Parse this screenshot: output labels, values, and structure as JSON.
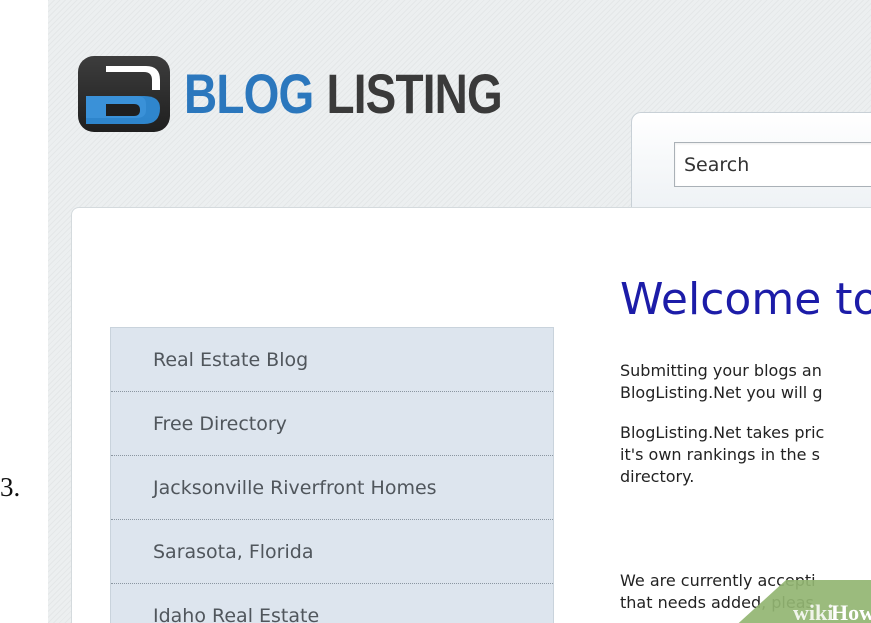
{
  "step": {
    "number": "3."
  },
  "logo": {
    "word1": "BLOG",
    "word2": "LISTING"
  },
  "search": {
    "value": "Search"
  },
  "sidebar": {
    "items": [
      {
        "label": "Real Estate Blog"
      },
      {
        "label": "Free Directory"
      },
      {
        "label": "Jacksonville Riverfront Homes"
      },
      {
        "label": "Sarasota, Florida"
      },
      {
        "label": "Idaho Real Estate"
      }
    ]
  },
  "content": {
    "title": "Welcome to",
    "paragraphs": [
      [
        "Submitting your blogs an",
        "BlogListing.Net you will g"
      ],
      [
        "BlogListing.Net takes pric",
        "it's own rankings in the s",
        "directory."
      ],
      [
        "We are currently accepti",
        "that needs added, pleas"
      ]
    ]
  },
  "watermark": {
    "text1": "wiki",
    "text2": "How"
  },
  "colors": {
    "brand_blue": "#2b77bd",
    "title_blue": "#1c1ca8",
    "sidebar_bg": "#dde5ee"
  }
}
